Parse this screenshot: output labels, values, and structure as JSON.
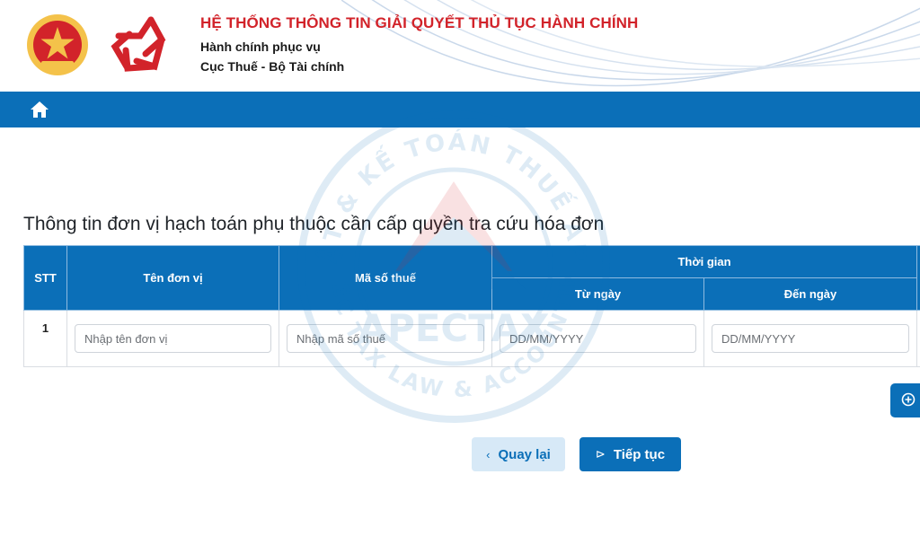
{
  "header": {
    "title": "HỆ THỐNG THÔNG TIN GIẢI QUYẾT THỦ TỤC HÀNH CHÍNH",
    "subtitle1": "Hành chính phục vụ",
    "subtitle2": "Cục Thuế - Bộ Tài chính"
  },
  "section": {
    "title": "Thông tin đơn vị hạch toán phụ thuộc cần cấp quyền tra cứu hóa đơn"
  },
  "table": {
    "headers": {
      "stt": "STT",
      "unit_name": "Tên đơn vị",
      "tax_code": "Mã số thuế",
      "time": "Thời gian",
      "from_date": "Từ ngày",
      "to_date": "Đến ngày"
    },
    "rows": [
      {
        "stt": "1",
        "unit_name_placeholder": "Nhập tên đơn vị",
        "tax_code_placeholder": "Nhập mã số thuế",
        "from_date_placeholder": "DD/MM/YYYY",
        "to_date_placeholder": "DD/MM/YYYY"
      }
    ]
  },
  "buttons": {
    "back": "Quay lại",
    "back_icon": "‹",
    "next": "Tiếp tục",
    "next_icon": "⊳"
  },
  "watermark": {
    "brand": "APECTAX",
    "ring_text_top": "LUẬT & KẾ TOÁN THUẾ APEC",
    "ring_text_bottom": "APEC TAX LAW & ACCOUNTING"
  },
  "colors": {
    "primary": "#0b6fb8",
    "title_red": "#d2232a",
    "secondary_bg": "#d7e9f7"
  },
  "icons": {
    "home": "home-icon",
    "add": "plus-circle-icon",
    "back": "chevron-left-icon",
    "next": "step-forward-icon"
  }
}
